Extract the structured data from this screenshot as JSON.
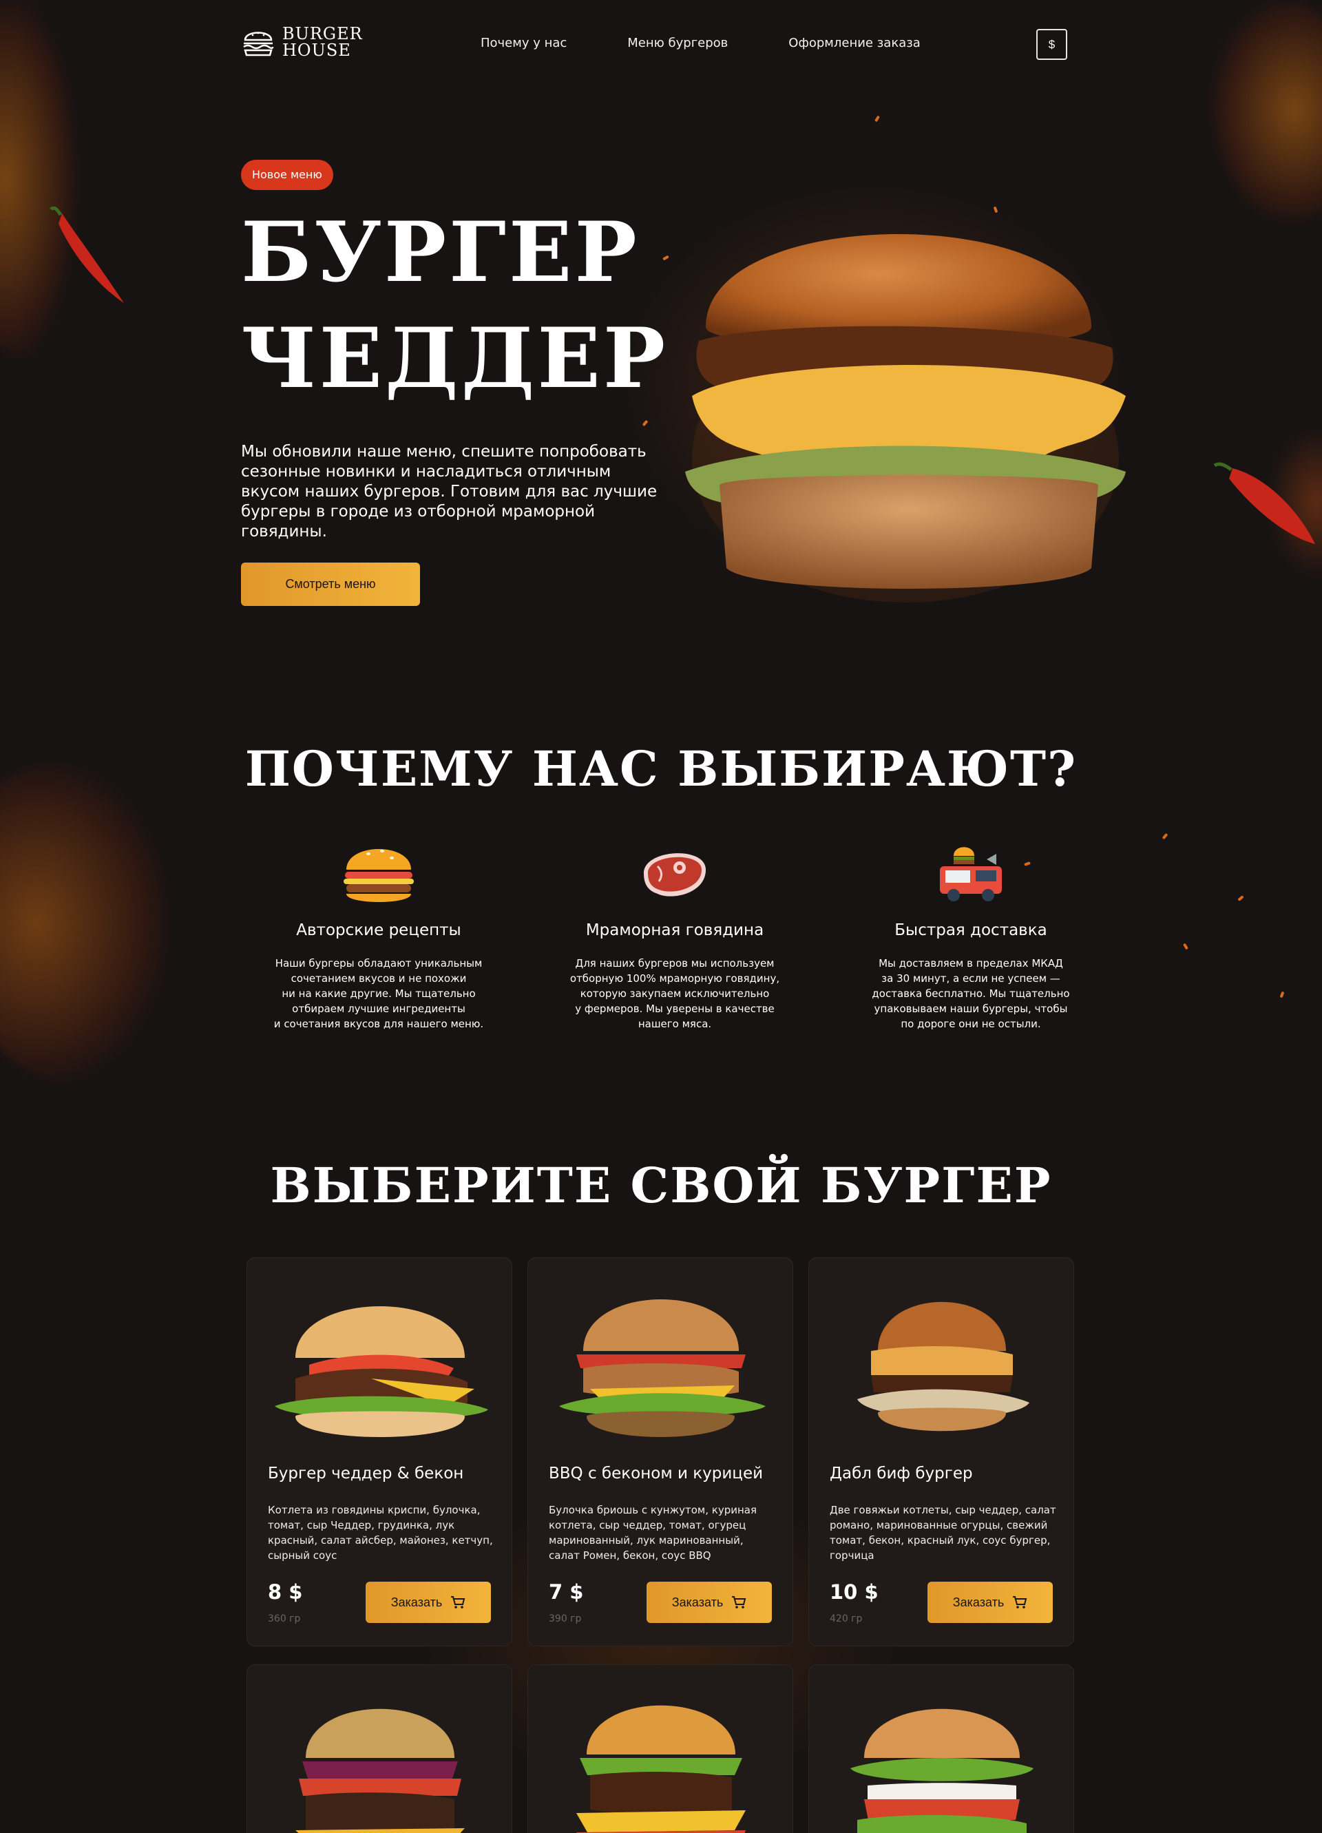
{
  "header": {
    "logo_line1": "BURGER",
    "logo_line2": "HOUSE",
    "nav": [
      {
        "label": "Почему у нас"
      },
      {
        "label": "Меню бургеров"
      },
      {
        "label": "Оформление заказа"
      }
    ],
    "currency": "$"
  },
  "hero": {
    "badge": "Новое меню",
    "title_line1": "БУРГЕР",
    "title_line2": "ЧЕДДЕР",
    "text": "Мы обновили наше меню, спешите попробовать сезонные новинки и насладиться отличным вкусом наших бургеров. Готовим для вас лучшие бургеры в городе из отборной мраморной говядины.",
    "cta": "Смотреть меню"
  },
  "why": {
    "title": "ПОЧЕМУ НАС ВЫБИРАЮТ?",
    "features": [
      {
        "icon": "burger-icon",
        "title": "Авторские рецепты",
        "text": "Наши бургеры обладают уникальным\nсочетанием вкусов и не похожи\nни на какие другие. Мы тщательно\nотбираем лучшие ингредиенты\nи сочетания вкусов для нашего меню."
      },
      {
        "icon": "steak-icon",
        "title": "Мраморная говядина",
        "text": "Для наших бургеров мы используем\nотборную 100% мраморную говядину,\nкоторую закупаем исключительно\nу фермеров. Мы уверены в качестве\nнашего мяса."
      },
      {
        "icon": "food-truck-icon",
        "title": "Быстрая доставка",
        "text": "Мы доставляем в пределах МКАД\nза 30 минут, а если не успеем —\nдоставка бесплатно. Мы тщательно\nупаковываем наши бургеры, чтобы\nпо дороге они не остыли."
      }
    ]
  },
  "menu": {
    "title": "ВЫБЕРИТЕ СВОЙ БУРГЕР",
    "order_label": "Заказать",
    "items": [
      {
        "name": "Бургер чеддер & бекон",
        "desc": "Котлета из говядины криспи, булочка, томат, сыр Чеддер, грудинка, лук красный, салат айсбер, майонез, кетчуп, сырный соус",
        "price": "8 $",
        "weight": "360 гр"
      },
      {
        "name": "BBQ с беконом и курицей",
        "desc": "Булочка бриошь с кунжутом, куриная котлета, сыр чеддер, томат, огурец маринованный, лук маринованный, салат Ромен, бекон, соус BBQ",
        "price": "7 $",
        "weight": "390 гр"
      },
      {
        "name": "Дабл биф бургер",
        "desc": "Две говяжьи котлеты, сыр чеддер, салат романо, маринованные огурцы, свежий томат, бекон, красный лук, соус бургер, горчица",
        "price": "10 $",
        "weight": "420 гр"
      }
    ]
  },
  "colors": {
    "background": "#181313",
    "accent": "#f2b43a",
    "badge": "#d8371b",
    "card": "#201a19"
  }
}
